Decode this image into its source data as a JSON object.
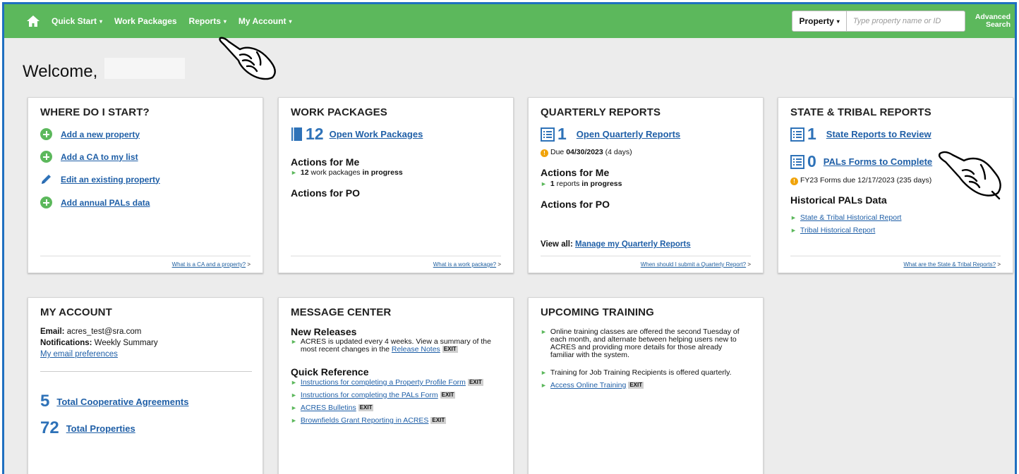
{
  "nav": {
    "home_icon": "home-icon",
    "items": [
      {
        "label": "Quick Start",
        "caret": "▾"
      },
      {
        "label": "Work Packages",
        "caret": ""
      },
      {
        "label": "Reports",
        "caret": "▾"
      },
      {
        "label": "My Account",
        "caret": "▾"
      }
    ],
    "search_type": "Property",
    "search_caret": "▾",
    "search_placeholder": "Type property name or ID",
    "advanced_line1": "Advanced",
    "advanced_line2": "Search"
  },
  "welcome": "Welcome,",
  "where_start": {
    "title": "WHERE DO I START?",
    "items": [
      "Add a new property",
      "Add a CA to my list",
      "Edit an existing property",
      "Add annual PALs data"
    ],
    "footer_link": "What is a CA and a property?",
    "footer_suffix": " >"
  },
  "work_packages": {
    "title": "WORK PACKAGES",
    "count": "12",
    "link": "Open Work Packages",
    "actions_me": "Actions for Me",
    "me_count": "12",
    "me_text": " work packages ",
    "me_bold": "in progress",
    "actions_po": "Actions for PO",
    "footer_link": "What is a work package?",
    "footer_suffix": " >"
  },
  "quarterly": {
    "title": "QUARTERLY REPORTS",
    "count": "1",
    "link": "Open Quarterly Reports",
    "due_prefix": "Due ",
    "due_date": "04/30/2023",
    "due_suffix": " (4 days)",
    "actions_me": "Actions for Me",
    "me_count": "1",
    "me_text": " reports ",
    "me_bold": "in progress",
    "actions_po": "Actions for PO",
    "view_all": "View all: ",
    "view_link": "Manage my Quarterly Reports",
    "footer_link": "When should I submit a Quarterly Report?",
    "footer_suffix": " >"
  },
  "state_tribal": {
    "title": "STATE & TRIBAL REPORTS",
    "count1": "1",
    "link1": "State Reports to Review",
    "count2": "0",
    "link2": "PALs Forms to Complete",
    "due_text": "FY23 Forms due 12/17/2023 (235 days)",
    "hist_title": "Historical PALs Data",
    "hist_links": [
      "State & Tribal Historical Report",
      "Tribal Historical Report"
    ],
    "footer_link": "What are the State & Tribal Reports?",
    "footer_suffix": " >"
  },
  "my_account": {
    "title": "MY ACCOUNT",
    "email_label": "Email:",
    "email": " acres_test@sra.com",
    "notif_label": "Notifications:",
    "notif": " Weekly Summary",
    "prefs_link": "My email preferences",
    "ca_count": "5",
    "ca_link": "Total Cooperative Agreements",
    "prop_count": "72",
    "prop_link": "Total Properties"
  },
  "message_center": {
    "title": "MESSAGE CENTER",
    "new_releases": "New Releases",
    "release_text": "ACRES is updated every 4 weeks. View a summary of the most recent changes in the ",
    "release_link": "Release Notes",
    "quick_ref": "Quick Reference",
    "quick_links": [
      "Instructions for completing a Property Profile Form",
      "Instructions for completing the PALs Form",
      "ACRES Bulletins",
      "Brownfields Grant Reporting in ACRES"
    ],
    "exit": "EXIT"
  },
  "training": {
    "title": "UPCOMING TRAINING",
    "item1": "Online training classes are offered the second Tuesday of each month, and alternate between helping users new to ACRES and providing more details for those already familiar with the system.",
    "item2": "Training for Job Training Recipients is offered quarterly.",
    "link": "Access Online Training",
    "exit": "EXIT"
  },
  "colors": {
    "nav_green": "#5cb85c",
    "link_blue": "#1f5fa7",
    "accent_blue": "#2e72b8",
    "frame_blue": "#1f6fc0"
  }
}
